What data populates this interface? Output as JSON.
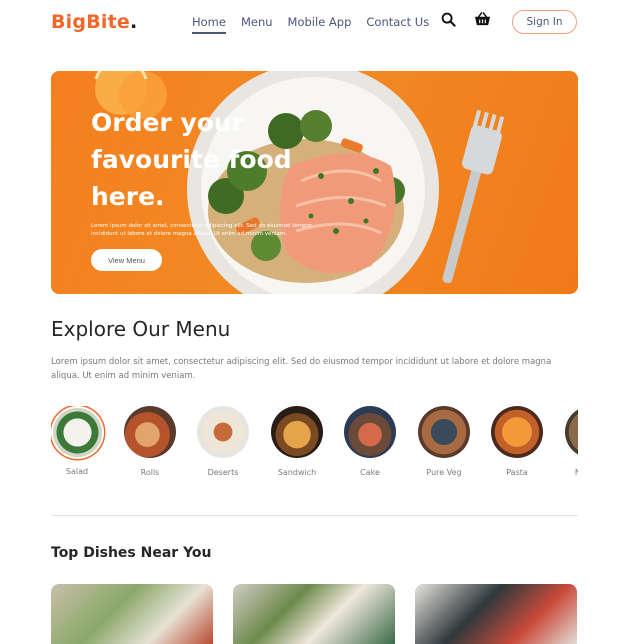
{
  "brand": {
    "name": "BigBite",
    "dot": "."
  },
  "nav": {
    "items": [
      "Home",
      "Menu",
      "Mobile App",
      "Contact Us"
    ],
    "active": "Home",
    "signin_label": "Sign In"
  },
  "icons": {
    "search": "search-icon",
    "basket": "basket-icon"
  },
  "hero": {
    "title": "Order your favourite food here.",
    "text": "Lorem ipsum dolor sit amet, consectetur adipiscing elit. Sed do eiusmod tempor incididunt ut labore et dolore magna aliqua. Ut enim ad minim veniam.",
    "button_label": "View Menu"
  },
  "explore": {
    "title": "Explore Our Menu",
    "text": "Lorem ipsum dolor sit amet, consectetur adipiscing elit. Sed do eiusmod tempor incididunt ut labore et dolore magna aliqua. Ut enim ad minim veniam.",
    "items": [
      {
        "label": "Salad"
      },
      {
        "label": "Rolls"
      },
      {
        "label": "Deserts"
      },
      {
        "label": "Sandwich"
      },
      {
        "label": "Cake"
      },
      {
        "label": "Pure Veg"
      },
      {
        "label": "Pasta"
      },
      {
        "label": "Noodles"
      }
    ]
  },
  "top_dishes": {
    "title": "Top Dishes Near You"
  },
  "colors": {
    "accent": "#f0672a",
    "hero": "#f28a24",
    "nav_text": "#49557e"
  }
}
